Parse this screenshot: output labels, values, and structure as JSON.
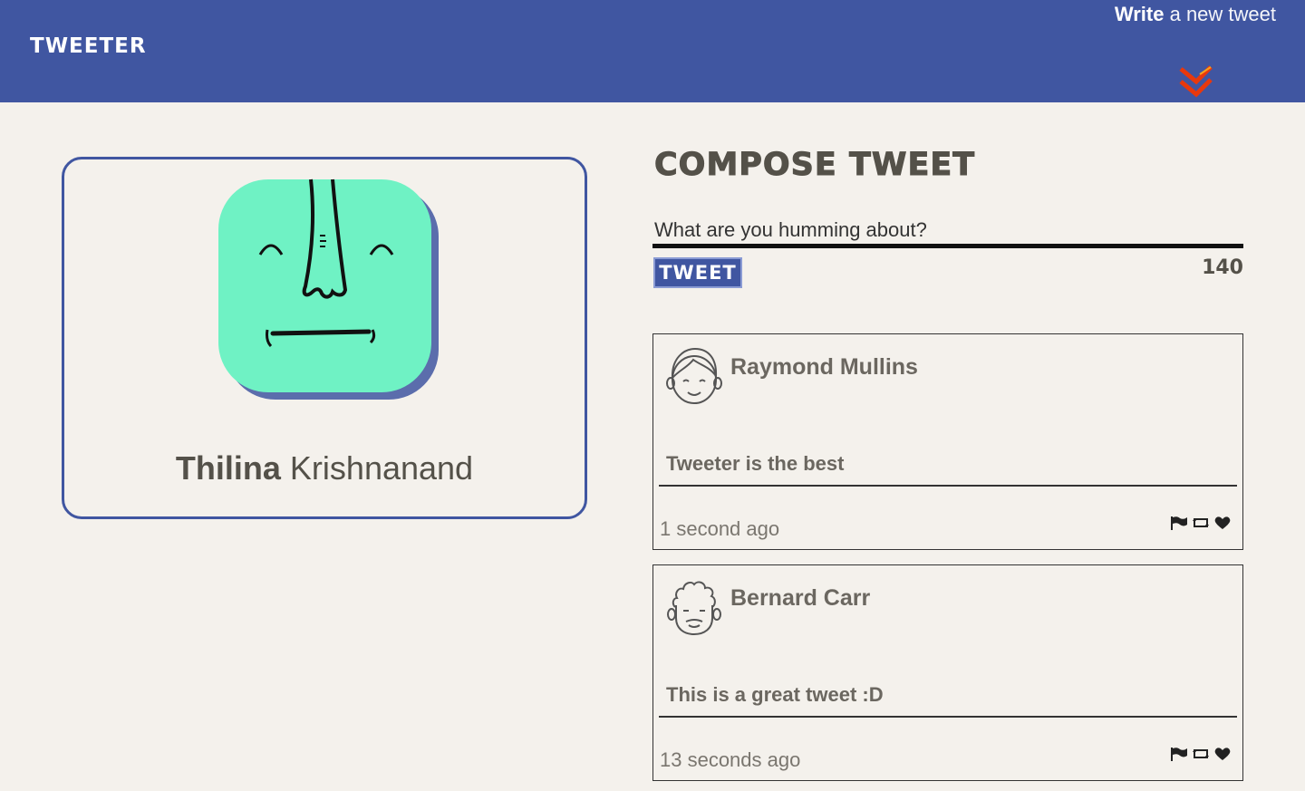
{
  "nav": {
    "brand": "TWEETER",
    "write_bold": "Write",
    "write_rest": " a new tweet",
    "chevron_icon": "double-chevron-down-icon",
    "colors": {
      "bar": "#4056a1",
      "chevron": "#e8380d"
    }
  },
  "profile": {
    "first_name": "Thilina",
    "last_name": " Krishnanand",
    "avatar_icon": "face-avatar-icon",
    "avatar_color": "#6ff2c4"
  },
  "compose": {
    "title": "COMPOSE TWEET",
    "placeholder": "What are you humming about?",
    "value": "",
    "tweet_button": "TWEET",
    "counter": "140"
  },
  "tweets": [
    {
      "author": "Raymond Mullins",
      "body": "Tweeter is the best",
      "time": "1 second ago",
      "avatar_icon": "boy-avatar-icon",
      "actions": [
        "flag-icon",
        "retweet-icon",
        "heart-icon"
      ]
    },
    {
      "author": "Bernard Carr",
      "body": "This is a great tweet :D",
      "time": "13 seconds ago",
      "avatar_icon": "curly-hair-avatar-icon",
      "actions": [
        "flag-icon",
        "retweet-icon",
        "heart-icon"
      ]
    }
  ]
}
